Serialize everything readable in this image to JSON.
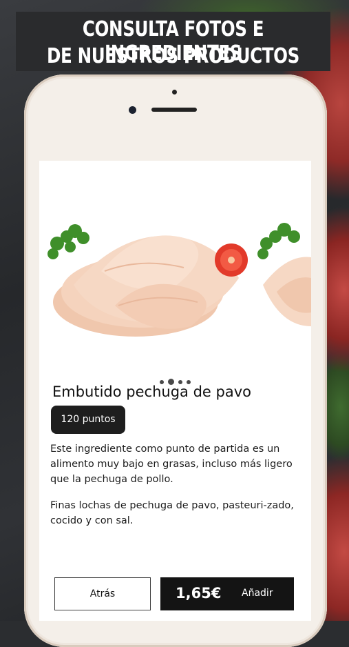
{
  "banner": {
    "line1": "CONSULTA FOTOS E INGREDIENTES",
    "line2": "DE NUESTROS PRODUCTOS"
  },
  "product": {
    "name": "Embutido pechuga de pavo",
    "points": "120 puntos",
    "description_1": "Este ingrediente como punto de partida es un alimento muy bajo en grasas, incluso más ligero que la pechuga de pollo.",
    "description_2": "Finas lochas de pechuga de pavo, pasteuri-zado, cocido y con sal.",
    "price": "1,65€"
  },
  "gallery": {
    "image_count": 4,
    "active_index": 1
  },
  "actions": {
    "back_label": "Atrás",
    "add_label": "Añadir"
  }
}
